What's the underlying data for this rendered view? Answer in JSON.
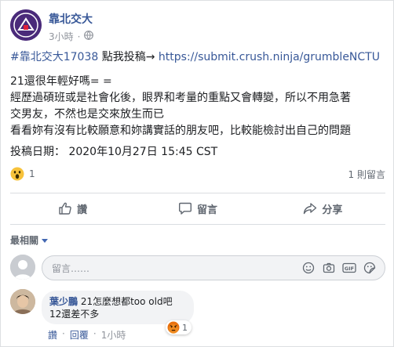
{
  "header": {
    "page_name": "靠北交大",
    "time": "3小時",
    "separator": "·"
  },
  "post": {
    "hashtag": "#靠北交大17038",
    "cta": " 點我投稿→ ",
    "url": "https://submit.crush.ninja/grumbleNCTU",
    "lines": [
      "21還很年輕好嗎= =",
      "經歷過碩班或是社會化後，眼界和考量的重點又會轉變，所以不用急著",
      "交男友，不然也是交來放生而已",
      "看看妳有沒有比較願意和妳講實話的朋友吧，比較能檢討出自己的問題"
    ],
    "date_line": "投稿日期： 2020年10月27日 15:45 CST"
  },
  "summary": {
    "reaction_count": "1",
    "comments_count": "1 則留言"
  },
  "actions": {
    "like": "讚",
    "comment": "留言",
    "share": "分享"
  },
  "sort": {
    "label": "最相關"
  },
  "composer": {
    "placeholder": "留言……"
  },
  "comment": {
    "author": "葉少鵬",
    "text_1": " 21怎麼想都too old吧",
    "text_2": "12還差不多",
    "reaction_count": "1",
    "like": "讚",
    "reply": "回覆",
    "dot": "·",
    "time": "1小時"
  },
  "colors": {
    "link": "#385898",
    "secondary": "#606770",
    "muted": "#90949c",
    "accent": "#4267b2"
  }
}
